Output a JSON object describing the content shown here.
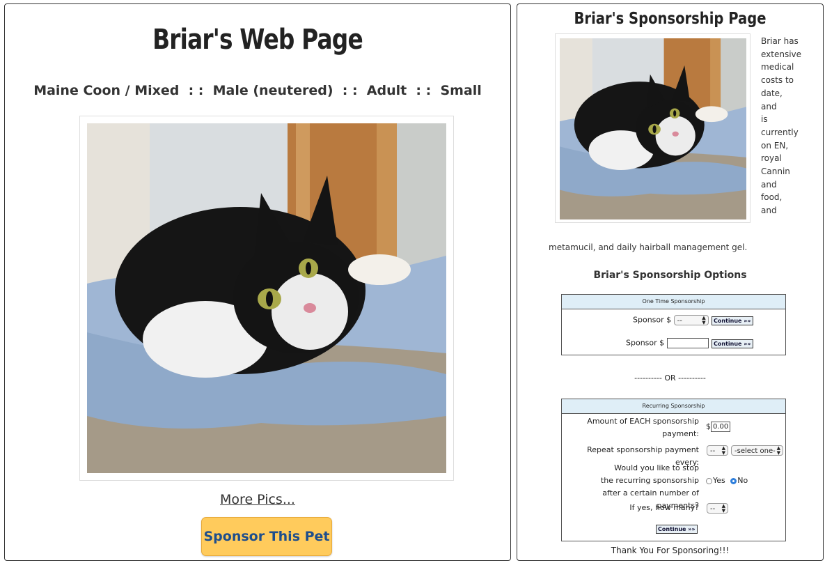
{
  "left": {
    "title": "Briar's Web Page",
    "subtitle": "Maine Coon / Mixed  : :  Male (neutered)  : :  Adult  : :  Small",
    "more_pics": "More Pics...",
    "sponsor_button": "Sponsor This Pet"
  },
  "right": {
    "title": "Briar's Sponsorship Page",
    "description_lines": [
      "Briar has",
      "extensive",
      "medical",
      "costs to",
      "date, and",
      "is",
      "currently",
      "on EN,",
      "royal",
      "Cannin",
      "and food,",
      "and"
    ],
    "description_rest": "metamucil, and daily hairball management gel.",
    "options_title": "Briar's Sponsorship Options",
    "one_time": {
      "header": "One Time Sponsorship",
      "label1": "Sponsor $",
      "select_value": "--",
      "continue1": "Continue »»",
      "label2": "Sponsor $",
      "input_value": "",
      "continue2": "Continue »»"
    },
    "or_text": "---------- OR ----------",
    "recurring": {
      "header": "Recurring Sponsorship",
      "amount_label_1": "Amount of EACH sponsorship",
      "amount_label_2": "payment:",
      "dollar": "$",
      "amount_value": "0.00",
      "repeat_label": "Repeat sponsorship payment every:",
      "repeat_num": "--",
      "repeat_unit": "-select one-",
      "stop_label_1": "Would you like to stop",
      "stop_label_2": "the recurring sponsorship",
      "stop_label_3": "after a certain number of payments?",
      "yes": "Yes",
      "no": "No",
      "how_many_label": "If yes, how many?",
      "how_many_value": "--",
      "continue": "Continue »»"
    },
    "thanks": "Thank You For Sponsoring!!!"
  }
}
